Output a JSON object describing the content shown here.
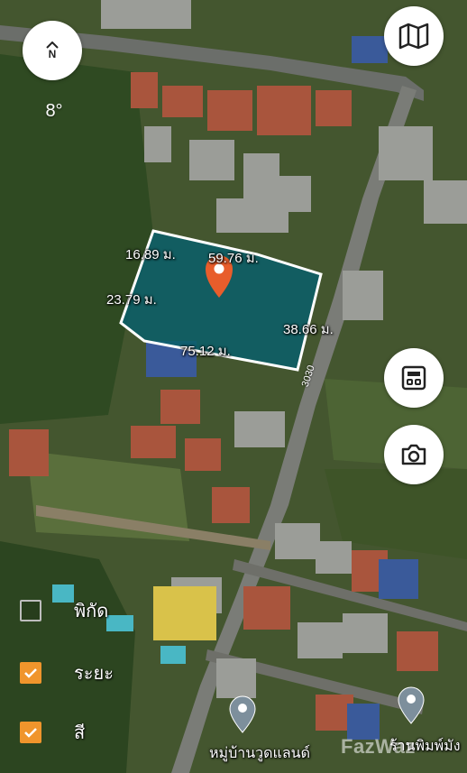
{
  "map": {
    "compass_letter": "N",
    "heading": "8°",
    "road_number": "3030",
    "plot": {
      "fill_color": "#0b5e69",
      "border_color": "#ffffff",
      "dimensions": [
        {
          "id": "top-left",
          "text": "16.89 ม."
        },
        {
          "id": "top-right",
          "text": "59.76 ม."
        },
        {
          "id": "left",
          "text": "23.79 ม."
        },
        {
          "id": "right",
          "text": "38.66 ม."
        },
        {
          "id": "bottom",
          "text": "75.12 ม."
        }
      ]
    },
    "pin_color": "#e85d2b",
    "pois": [
      {
        "name": "หมู่บ้านวูดแลนด์"
      },
      {
        "name": "ร้านพิมพ์มัง"
      }
    ]
  },
  "controls": {
    "map_button_icon": "map-icon",
    "calculator_icon": "calculator-icon",
    "camera_icon": "camera-icon"
  },
  "toggles": [
    {
      "label": "พิกัด",
      "checked": false
    },
    {
      "label": "ระยะ",
      "checked": true
    },
    {
      "label": "สี",
      "checked": true
    }
  ],
  "accent_color": "#f0952c",
  "watermark": "FazWaz"
}
